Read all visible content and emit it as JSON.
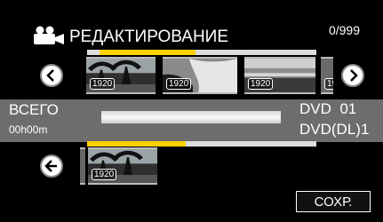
{
  "header": {
    "title": "РЕДАКТИРОВАНИЕ",
    "counter": "0/999",
    "icon": "movie-camera-icon"
  },
  "top_strip": {
    "progress": 0.42,
    "thumbnails": [
      {
        "badge": "1920"
      },
      {
        "badge": "1920"
      },
      {
        "badge": "1920"
      },
      {
        "badge": "19"
      }
    ]
  },
  "info": {
    "total_label": "ВСЕГО",
    "total_time": "00h00m",
    "disc_line1": "DVD  01",
    "disc_line2": "DVD(DL)1"
  },
  "bottom_strip": {
    "progress": 0.43,
    "thumbnails": [
      {
        "badge": "1920"
      }
    ]
  },
  "buttons": {
    "save": "СОХР."
  },
  "colors": {
    "accent": "#ffd000",
    "band": "#6d6d6d",
    "background": "#000000"
  }
}
